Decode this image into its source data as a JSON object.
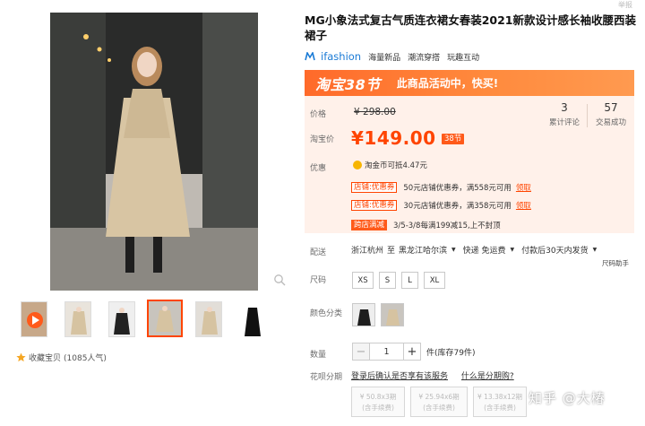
{
  "corner_text": "举报",
  "product": {
    "title": "MG小象法式复古气质连衣裙女春装2021新款设计感长袖收腰西装裙子",
    "brand": {
      "name": "ifashion",
      "tags": [
        "海量新品",
        "潮流穿搭",
        "玩趣互动"
      ]
    }
  },
  "promo": {
    "logo": "淘宝38节",
    "message": "此商品活动中，快买!"
  },
  "price": {
    "label": "价格",
    "original": "¥ 298.00",
    "taobao_label": "淘宝价",
    "current": "¥149.00",
    "badge": "38节"
  },
  "stats": [
    {
      "value": "3",
      "label": "累计评论"
    },
    {
      "value": "57",
      "label": "交易成功"
    }
  ],
  "offers": {
    "label": "优惠",
    "coin_text": "淘金币可抵4.47元",
    "coupons": [
      {
        "tag": "店铺:优惠券",
        "text": "50元店铺优惠券，满558元可用",
        "claim": "领取"
      },
      {
        "tag": "店铺:优惠券",
        "text": "30元店铺优惠券，满358元可用",
        "claim": "领取"
      },
      {
        "tag": "跨店满减",
        "text": "3/5-3/8每满199减15,上不封顶",
        "claim": ""
      }
    ]
  },
  "delivery": {
    "label": "配送",
    "from": "浙江杭州",
    "to_prefix": "至",
    "to": "黑龙江哈尔滨",
    "shipping": "快递 免运费",
    "promise": "付款后30天内发货",
    "size_help": "尺码助手"
  },
  "sizes": {
    "label": "尺码",
    "options": [
      "XS",
      "S",
      "L",
      "XL"
    ]
  },
  "colors": {
    "label": "颜色分类"
  },
  "quantity": {
    "label": "数量",
    "value": "1",
    "minus": "−",
    "plus": "+",
    "stock": "件(库存79件)"
  },
  "installment": {
    "label": "花呗分期",
    "login_text": "登录后确认是否享有该服务",
    "what_text": "什么是分期购?",
    "plans": [
      {
        "amount": "¥ 50.8x3期",
        "fee": "(含手续费)"
      },
      {
        "amount": "¥ 25.94x6期",
        "fee": "(含手续费)"
      },
      {
        "amount": "¥ 13.38x12期",
        "fee": "(含手续费)"
      }
    ]
  },
  "gallery": {
    "collect_text": "收藏宝贝",
    "collect_count": "(1085人气)"
  },
  "watermark": "知乎 @大椿",
  "colors_theme": {
    "accent": "#ff4400",
    "promo_gradient_start": "#ff6a2a",
    "price_bg": "#fff1ea",
    "brand_blue": "#1b7bd6"
  }
}
